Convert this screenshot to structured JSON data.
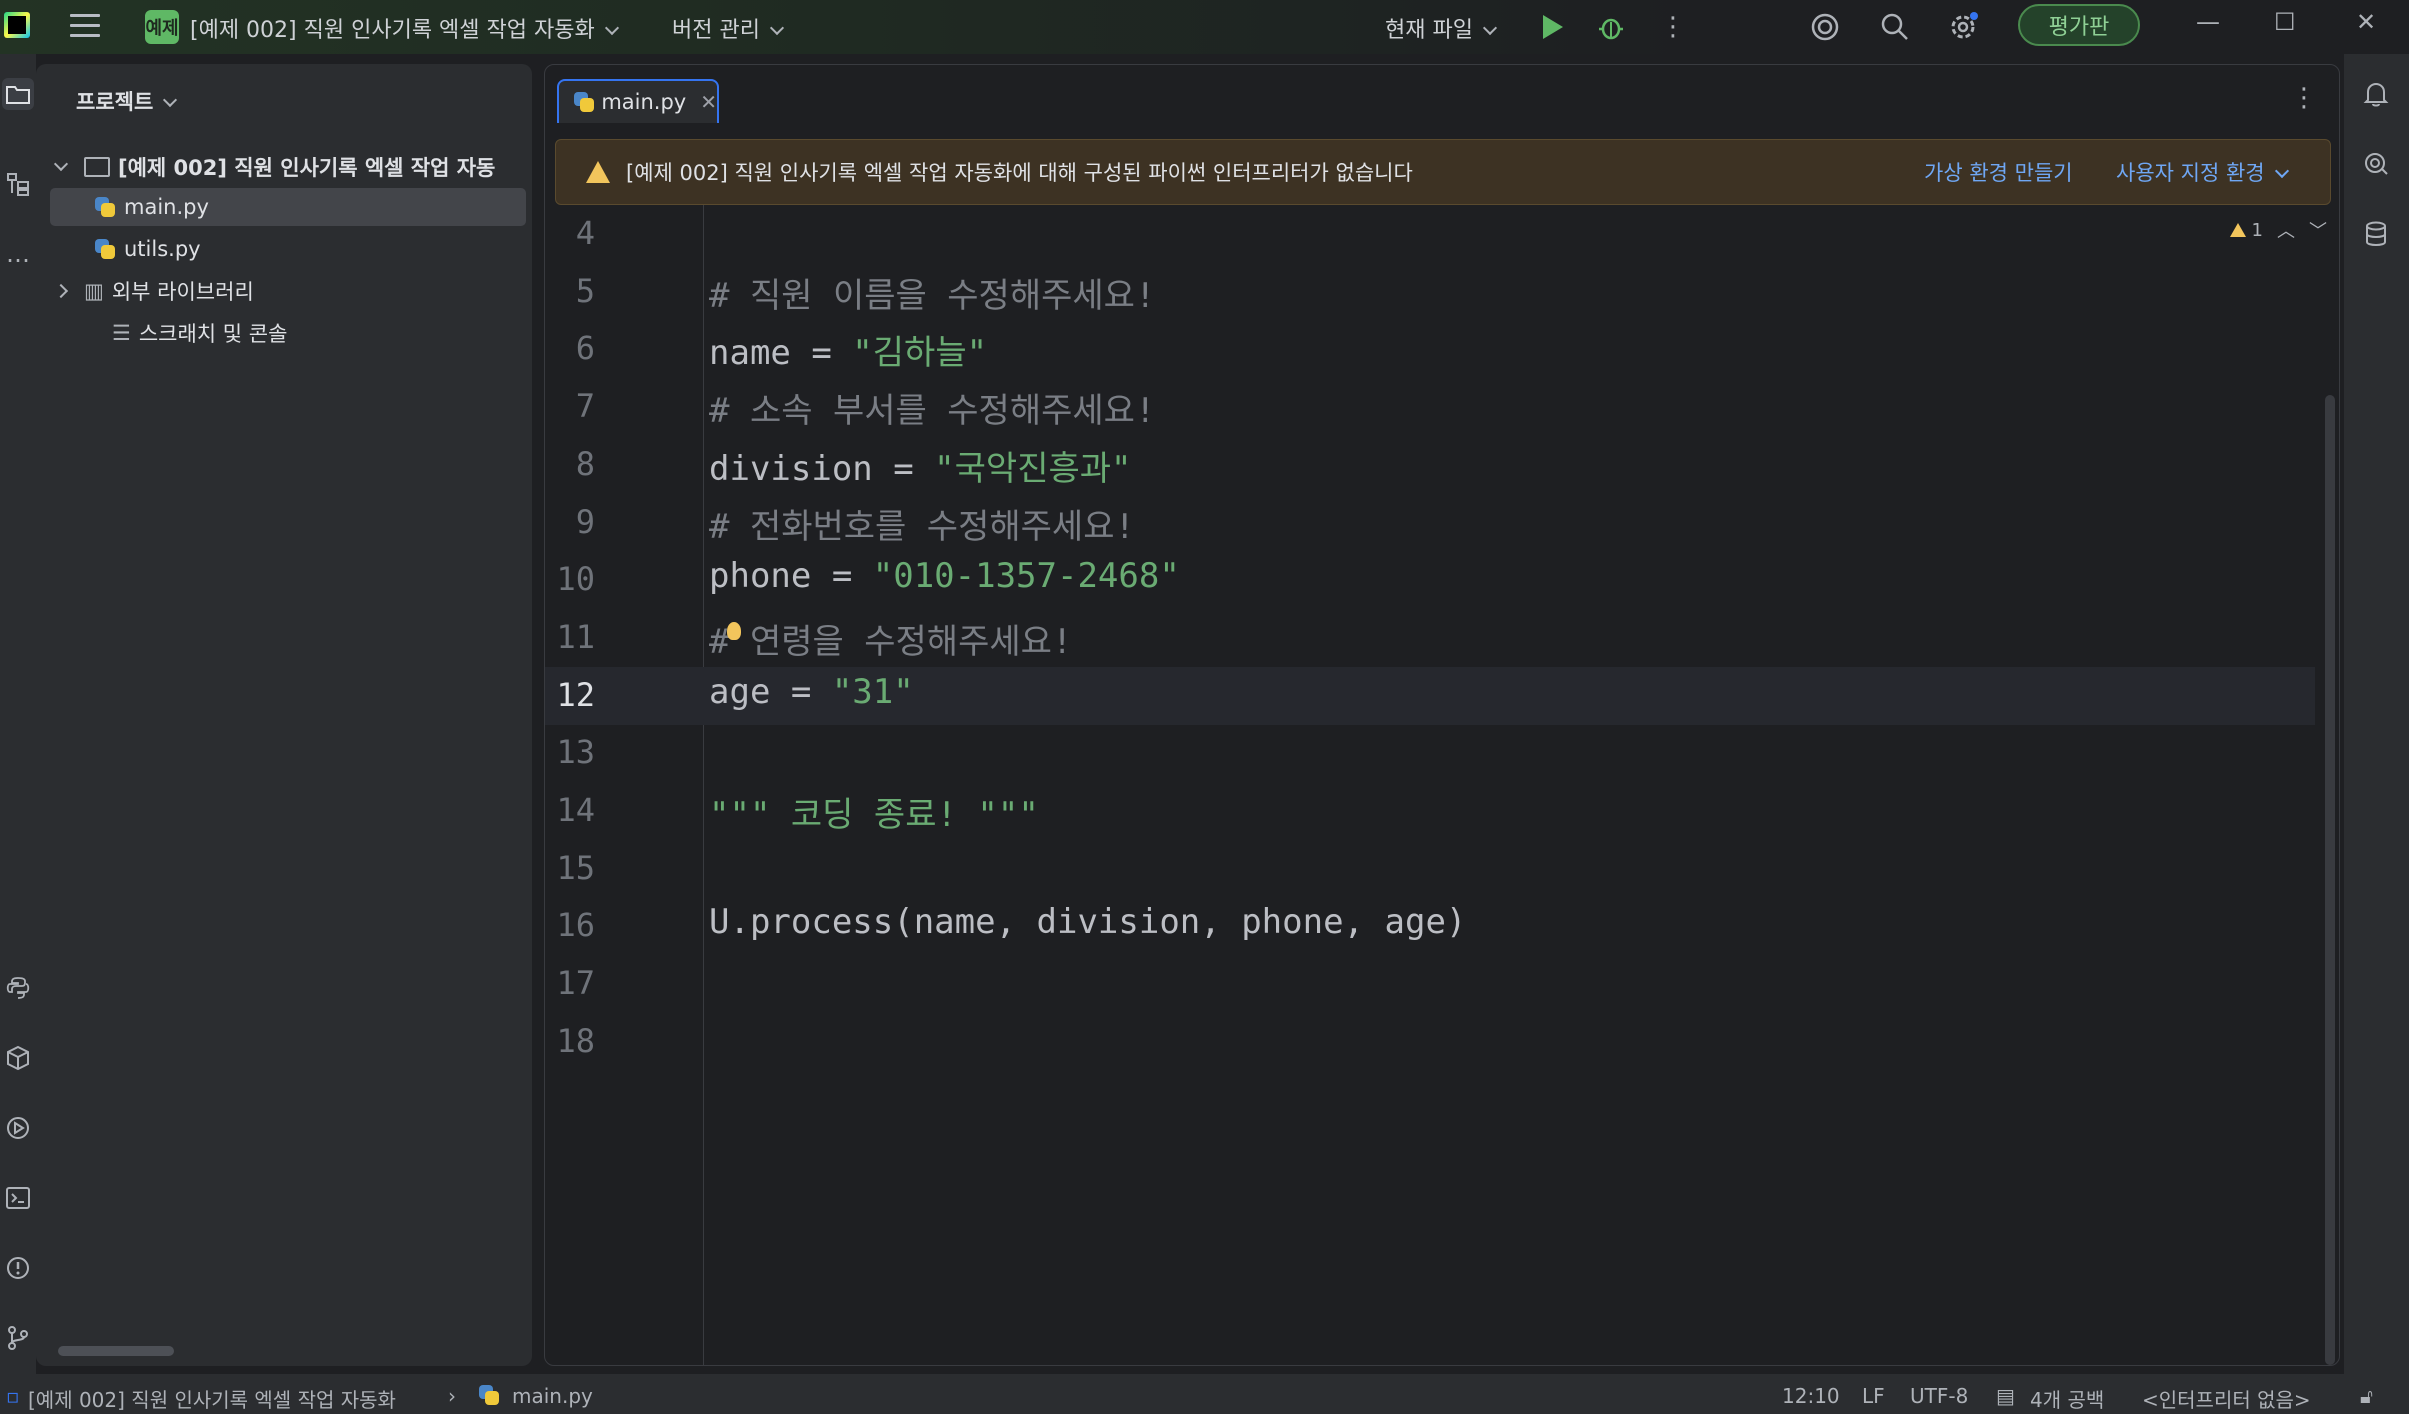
{
  "titlebar": {
    "project_badge": "예제",
    "project_name": "[예제 002] 직원 인사기록 엑셀 작업 자동화",
    "vcs_label": "버전 관리",
    "run_config": "현재 파일",
    "eval_label": "평가판"
  },
  "project_panel": {
    "title": "프로젝트",
    "root": "[예제 002] 직원 인사기록 엑셀 작업 자동",
    "files": [
      "main.py",
      "utils.py"
    ],
    "external_libs": "외부 라이브러리",
    "scratches": "스크래치 및 콘솔"
  },
  "editor": {
    "tab_label": "main.py",
    "banner_text": "[예제 002] 직원 인사기록 엑셀 작업 자동화에 대해 구성된 파이썬 인터프리터가 없습니다",
    "banner_link_venv": "가상 환경 만들기",
    "banner_link_custom": "사용자 지정 환경",
    "warning_count": "1",
    "lines": [
      {
        "num": "4",
        "text": "",
        "kind": "plain"
      },
      {
        "num": "5",
        "text": "# 직원 이름을 수정해주세요!",
        "kind": "comment"
      },
      {
        "num": "6",
        "text": "name = ",
        "str": "\"김하늘\"",
        "kind": "assign"
      },
      {
        "num": "7",
        "text": "# 소속 부서를 수정해주세요!",
        "kind": "comment"
      },
      {
        "num": "8",
        "text": "division = ",
        "str": "\"국악진흥과\"",
        "kind": "assign"
      },
      {
        "num": "9",
        "text": "# 전화번호를 수정해주세요!",
        "kind": "comment"
      },
      {
        "num": "10",
        "text": "phone = ",
        "str": "\"010-1357-2468\"",
        "kind": "assign"
      },
      {
        "num": "11",
        "text": "# 연령을 수정해주세요!",
        "kind": "comment"
      },
      {
        "num": "12",
        "text": "age = ",
        "str": "\"31\"",
        "kind": "assign"
      },
      {
        "num": "13",
        "text": "",
        "kind": "plain"
      },
      {
        "num": "14",
        "text": "",
        "str": "\"\"\" 코딩 종료! \"\"\"",
        "kind": "string"
      },
      {
        "num": "15",
        "text": "",
        "kind": "plain"
      },
      {
        "num": "16",
        "text": "U.process(name, division, phone, age)",
        "kind": "plain"
      },
      {
        "num": "17",
        "text": "",
        "kind": "plain"
      },
      {
        "num": "18",
        "text": "",
        "kind": "plain"
      }
    ]
  },
  "statusbar": {
    "breadcrumb_project": "[예제 002] 직원 인사기록 엑셀 작업 자동화",
    "breadcrumb_file": "main.py",
    "position": "12:10",
    "line_sep": "LF",
    "encoding": "UTF-8",
    "indent": "4개 공백",
    "interpreter": "<인터프리터 없음>"
  },
  "colors": {
    "accent": "#3574f0",
    "comment": "#7a7e85",
    "string": "#6aab73",
    "banner_bg": "#3d3223",
    "link": "#6fa7f4"
  }
}
